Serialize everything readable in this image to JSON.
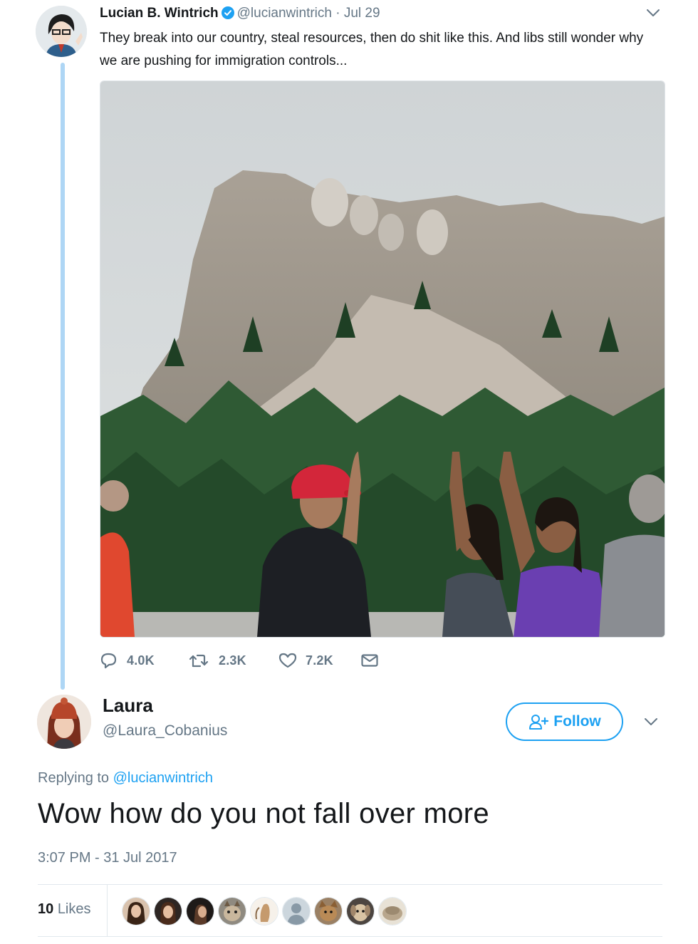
{
  "original_tweet": {
    "name": "Lucian B. Wintrich",
    "handle": "@lucianwintrich",
    "separator": "·",
    "date": "Jul 29",
    "text": "They break into our country, steal  resources, then do shit like this. And libs still wonder why we are pushing for immigration controls...",
    "verified": true,
    "actions": {
      "replies": "4.0K",
      "retweets": "2.3K",
      "likes": "7.2K"
    },
    "icons": [
      "verified-badge-icon",
      "chevron-down-icon",
      "reply-icon",
      "retweet-icon",
      "heart-icon",
      "envelope-icon"
    ]
  },
  "reply_tweet": {
    "name": "Laura",
    "handle": "@Laura_Cobanius",
    "follow_label": "Follow",
    "replying_prefix": "Replying to",
    "replying_to": "@lucianwintrich",
    "text": "Wow how do you not fall over more",
    "timestamp": "3:07 PM - 31 Jul 2017",
    "likes_count": "10",
    "likes_label": "Likes",
    "icons": [
      "follow-person-icon",
      "chevron-down-icon"
    ]
  },
  "colors": {
    "accent": "#1da1f2",
    "text_primary": "#14171a",
    "text_secondary": "#657786",
    "thread_line": "#aed6f5"
  }
}
